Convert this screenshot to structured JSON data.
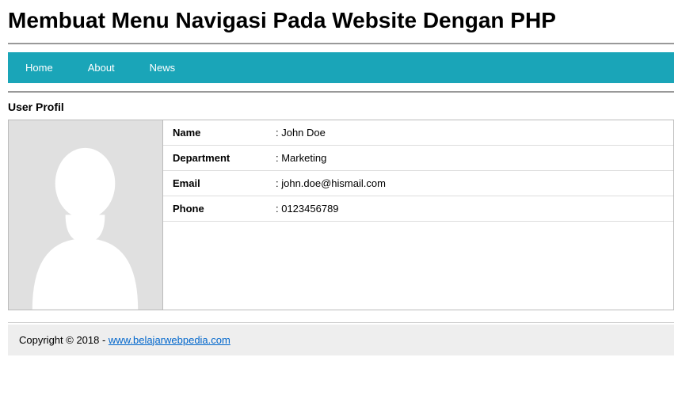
{
  "title": "Membuat Menu Navigasi Pada Website Dengan PHP",
  "nav": {
    "home": "Home",
    "about": "About",
    "news": "News"
  },
  "section_title": "User Profil",
  "profile": {
    "name_label": "Name",
    "name_value": ": John Doe",
    "department_label": "Department",
    "department_value": ": Marketing",
    "email_label": "Email",
    "email_value": ": john.doe@hismail.com",
    "phone_label": "Phone",
    "phone_value": ": 0123456789"
  },
  "footer": {
    "prefix": "Copyright © 2018 - ",
    "link_text": "www.belajarwebpedia.com"
  }
}
